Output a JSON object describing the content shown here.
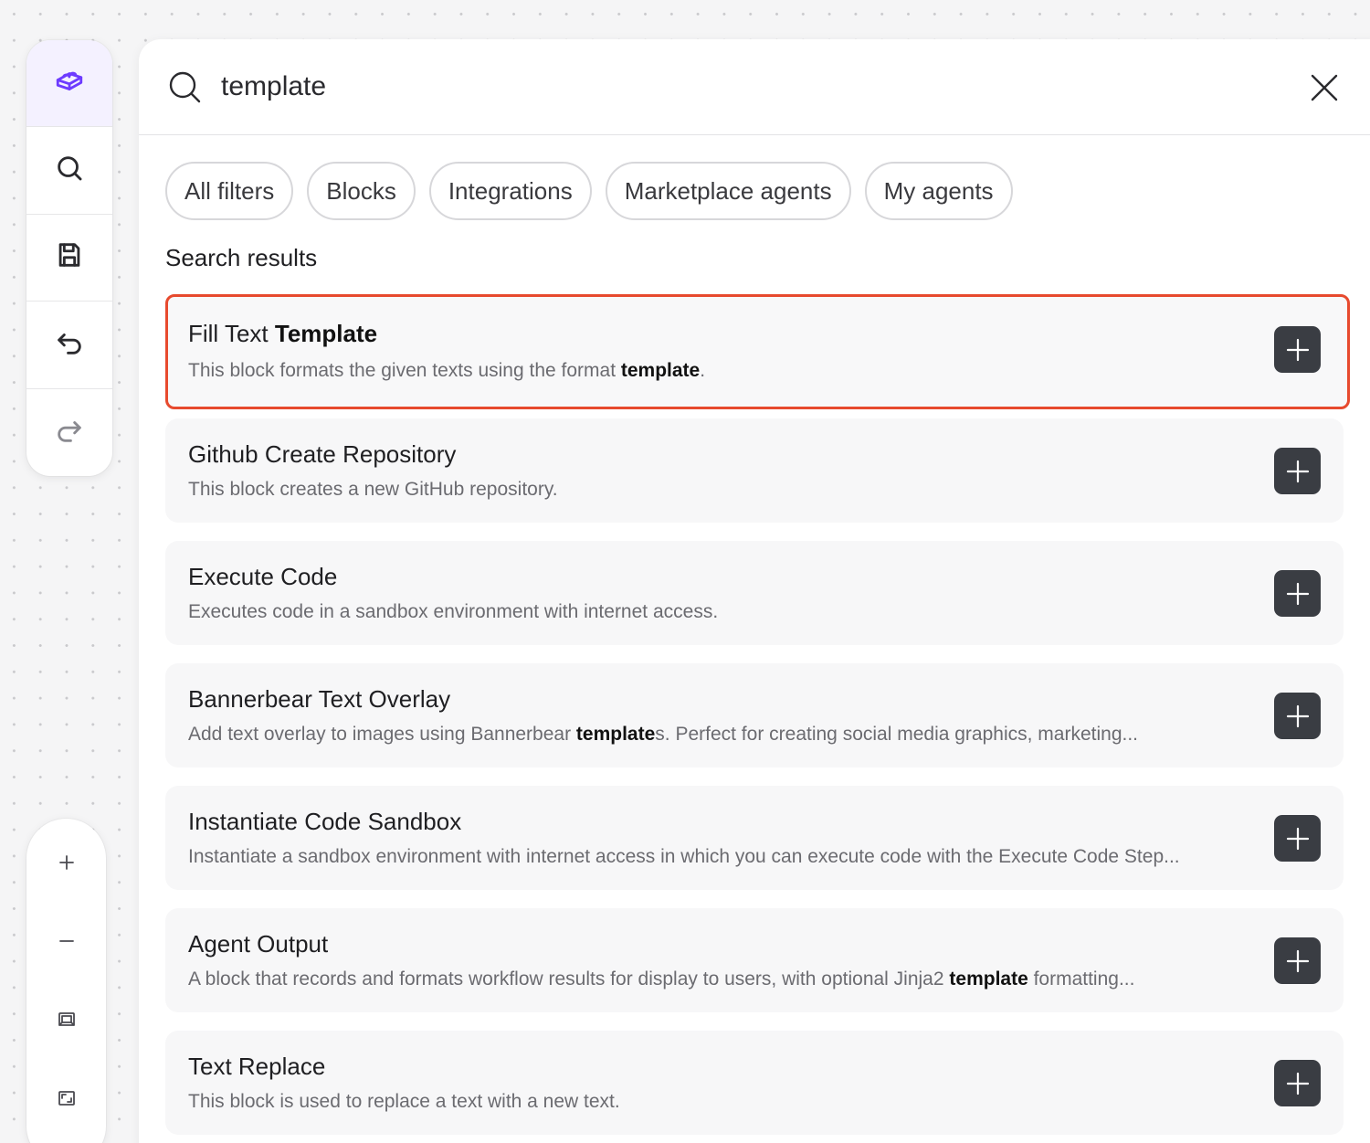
{
  "toolbar": {
    "items": [
      {
        "name": "blocks",
        "icon": "blocks-icon",
        "active": true
      },
      {
        "name": "search",
        "icon": "search-icon"
      },
      {
        "name": "save",
        "icon": "save-icon"
      },
      {
        "name": "undo",
        "icon": "undo-icon"
      },
      {
        "name": "redo",
        "icon": "redo-icon"
      }
    ]
  },
  "zoom_controls": [
    "zoom-in-icon",
    "zoom-out-icon",
    "fit-view-icon",
    "fullscreen-icon"
  ],
  "search": {
    "value": "template",
    "placeholder": "Search"
  },
  "filters": [
    "All filters",
    "Blocks",
    "Integrations",
    "Marketplace agents",
    "My agents"
  ],
  "section_title": "Search results",
  "results": [
    {
      "title_parts": [
        [
          "Fill Text ",
          false
        ],
        [
          "Template",
          true
        ]
      ],
      "desc_parts": [
        [
          "This block formats the given texts using the format ",
          false
        ],
        [
          "template",
          true
        ],
        [
          ".",
          false
        ]
      ],
      "selected": true
    },
    {
      "title_parts": [
        [
          "Github Create Repository",
          false
        ]
      ],
      "desc_parts": [
        [
          "This block creates a new GitHub repository.",
          false
        ]
      ]
    },
    {
      "title_parts": [
        [
          "Execute Code",
          false
        ]
      ],
      "desc_parts": [
        [
          "Executes code in a sandbox environment with internet access.",
          false
        ]
      ]
    },
    {
      "title_parts": [
        [
          "Bannerbear Text Overlay",
          false
        ]
      ],
      "desc_parts": [
        [
          "Add text overlay to images using Bannerbear ",
          false
        ],
        [
          "template",
          true
        ],
        [
          "s. Perfect for creating social media graphics, marketing...",
          false
        ]
      ]
    },
    {
      "title_parts": [
        [
          "Instantiate Code Sandbox",
          false
        ]
      ],
      "desc_parts": [
        [
          "Instantiate a sandbox environment with internet access in which you can execute code with the Execute Code Step...",
          false
        ]
      ]
    },
    {
      "title_parts": [
        [
          "Agent Output",
          false
        ]
      ],
      "desc_parts": [
        [
          "A block that records and formats workflow results for display to users, with optional Jinja2 ",
          false
        ],
        [
          "template",
          true
        ],
        [
          " formatting...",
          false
        ]
      ]
    },
    {
      "title_parts": [
        [
          "Text Replace",
          false
        ]
      ],
      "desc_parts": [
        [
          "This block is used to replace a text with a new text.",
          false
        ]
      ]
    }
  ],
  "colors": {
    "accent": "#6d3bff",
    "selection_border": "#e74a2e",
    "add_button": "#3a3d43"
  }
}
